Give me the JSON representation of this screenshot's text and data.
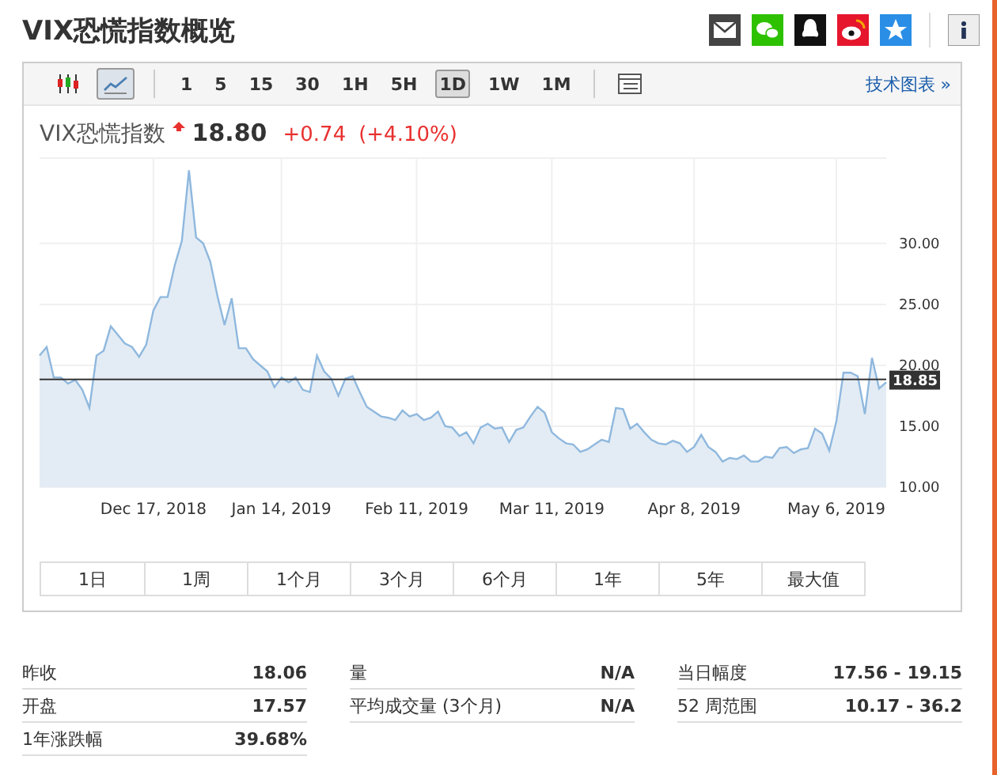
{
  "page_title": "VIX恐慌指数概览",
  "share_icons": [
    {
      "kind": "mail"
    },
    {
      "kind": "wechat"
    },
    {
      "kind": "qq"
    },
    {
      "kind": "weibo"
    },
    {
      "kind": "star"
    },
    {
      "kind": "info"
    }
  ],
  "toolbar": {
    "chart_types": [
      {
        "kind": "candle",
        "selected": false
      },
      {
        "kind": "line",
        "selected": true
      }
    ],
    "intervals": [
      {
        "label": "1",
        "selected": false
      },
      {
        "label": "5",
        "selected": false
      },
      {
        "label": "15",
        "selected": false
      },
      {
        "label": "30",
        "selected": false
      },
      {
        "label": "1H",
        "selected": false
      },
      {
        "label": "5H",
        "selected": false
      },
      {
        "label": "1D",
        "selected": true
      },
      {
        "label": "1W",
        "selected": false
      },
      {
        "label": "1M",
        "selected": false
      }
    ],
    "link": "技术图表 »"
  },
  "quote": {
    "name": "VIX恐慌指数",
    "rising": true,
    "price": "18.80",
    "change": "+0.74",
    "change_pct": "(+4.10%)"
  },
  "chart_data": {
    "type": "area",
    "grid": true,
    "series": [
      {
        "color": "#8fb8de",
        "values": [
          20.8,
          21.5,
          19,
          19,
          18.5,
          18.8,
          18,
          16.5,
          20.8,
          21.2,
          23.2,
          22.5,
          21.8,
          21.5,
          20.7,
          21.7,
          24.5,
          25.6,
          25.6,
          28.2,
          30.2,
          36.0,
          30.5,
          30,
          28.5,
          25.7,
          23.3,
          25.5,
          21.4,
          21.4,
          20.5,
          20,
          19.5,
          18.2,
          19,
          18.6,
          19,
          18,
          17.8,
          20.8,
          19.5,
          18.9,
          17.5,
          18.9,
          19.1,
          17.8,
          16.6,
          16.2,
          15.8,
          15.7,
          15.5,
          16.3,
          15.8,
          16,
          15.5,
          15.7,
          16.2,
          15,
          14.9,
          14.2,
          14.5,
          13.6,
          14.9,
          15.2,
          14.8,
          14.9,
          13.7,
          14.7,
          14.9,
          15.8,
          16.6,
          16.1,
          14.5,
          14,
          13.6,
          13.5,
          12.9,
          13.1,
          13.5,
          13.9,
          13.7,
          16.5,
          16.4,
          14.8,
          15.2,
          14.5,
          13.9,
          13.6,
          13.5,
          13.8,
          13.6,
          12.9,
          13.3,
          14.3,
          13.3,
          12.9,
          12.1,
          12.4,
          12.3,
          12.6,
          12.1,
          12.1,
          12.5,
          12.4,
          13.2,
          13.3,
          12.8,
          13.1,
          13.2,
          14.8,
          14.4,
          13.0,
          15.4,
          19.4,
          19.4,
          19.1,
          16.0,
          20.6,
          18.1,
          18.6
        ]
      }
    ],
    "categories": [
      null,
      null,
      null,
      null,
      null,
      null,
      null,
      null,
      null,
      null,
      null,
      null,
      null,
      null,
      null,
      null,
      "Dec 17, 2018",
      null,
      null,
      null,
      null,
      null,
      null,
      null,
      null,
      null,
      null,
      null,
      null,
      null,
      null,
      null,
      null,
      null,
      "Jan 14, 2019",
      null,
      null,
      null,
      null,
      null,
      null,
      null,
      null,
      null,
      null,
      null,
      null,
      null,
      null,
      null,
      null,
      null,
      null,
      "Feb 11, 2019",
      null,
      null,
      null,
      null,
      null,
      null,
      null,
      null,
      null,
      null,
      null,
      null,
      null,
      null,
      null,
      null,
      null,
      null,
      "Mar 11, 2019",
      null,
      null,
      null,
      null,
      null,
      null,
      null,
      null,
      null,
      null,
      null,
      null,
      null,
      null,
      null,
      null,
      null,
      null,
      null,
      "Apr 8, 2019",
      null,
      null,
      null,
      null,
      null,
      null,
      null,
      null,
      null,
      null,
      null,
      null,
      null,
      null,
      null,
      null,
      null,
      null,
      null,
      "May 6, 2019",
      null,
      null,
      null,
      null,
      null,
      null,
      null
    ],
    "ylim": [
      10,
      37
    ],
    "yticks": [
      {
        "value": 10,
        "label": "10.00"
      },
      {
        "value": 15,
        "label": "15.00"
      },
      {
        "value": 20,
        "label": "20.00"
      },
      {
        "value": 25,
        "label": "25.00"
      },
      {
        "value": 30,
        "label": "30.00"
      }
    ],
    "ref_lines": [
      {
        "axis": "y",
        "value": 18.85,
        "label": "18.85"
      }
    ]
  },
  "ranges": [
    {
      "label": "1日",
      "selected": false
    },
    {
      "label": "1周",
      "selected": false
    },
    {
      "label": "1个月",
      "selected": false
    },
    {
      "label": "3个月",
      "selected": false
    },
    {
      "label": "6个月",
      "selected": false
    },
    {
      "label": "1年",
      "selected": false
    },
    {
      "label": "5年",
      "selected": false
    },
    {
      "label": "最大值",
      "selected": false
    }
  ],
  "stats": [
    [
      {
        "label": "昨收",
        "value": "18.06"
      },
      {
        "label": "开盘",
        "value": "17.57"
      },
      {
        "label": "1年涨跌幅",
        "value": "39.68%"
      }
    ],
    [
      {
        "label": "量",
        "value": "N/A"
      },
      {
        "label": "平均成交量 (3个月)",
        "value": "N/A"
      }
    ],
    [
      {
        "label": "当日幅度",
        "value": "17.56 - 19.15"
      },
      {
        "label": "52 周范围",
        "value": "10.17 - 36.2"
      }
    ]
  ]
}
